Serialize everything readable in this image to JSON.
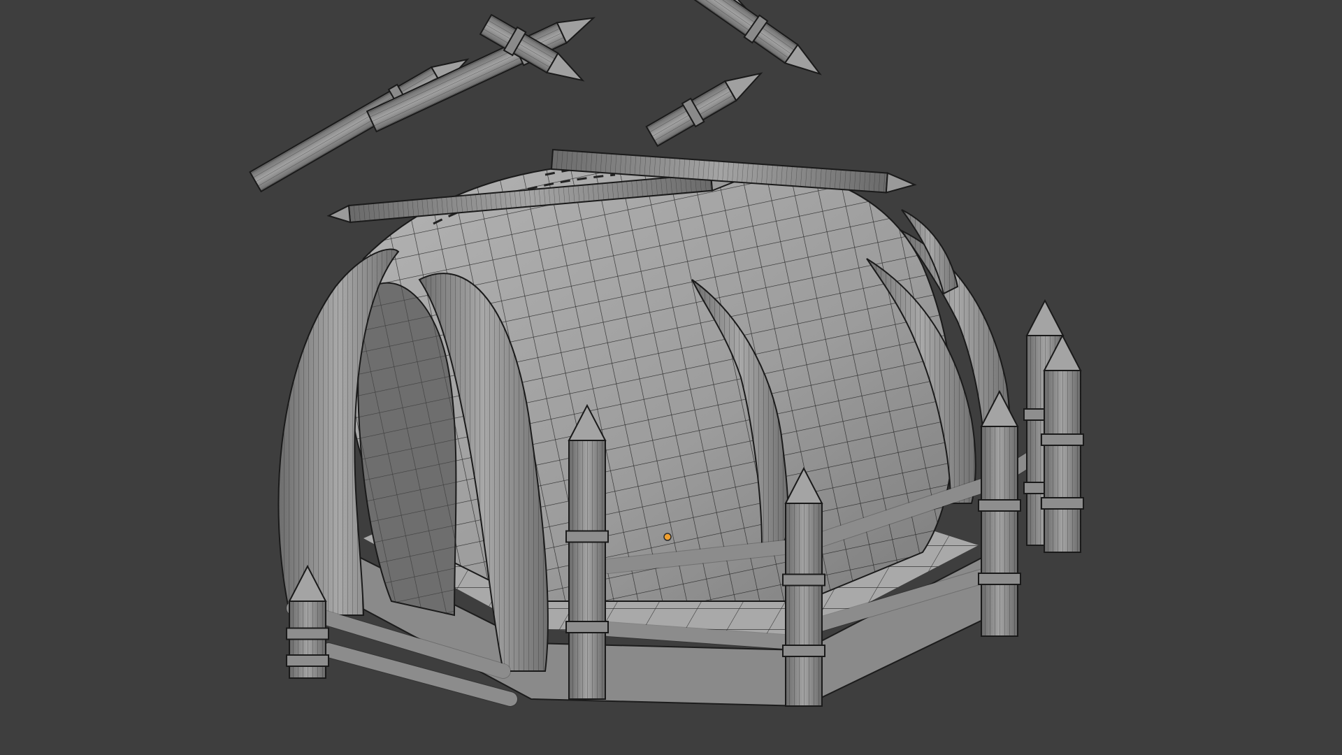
{
  "viewport": {
    "background_color": "#3e3e3e",
    "mode": "wireframe-overlay",
    "object_name": "",
    "selected_origin_color": "#f0a030"
  },
  "model": {
    "surface_color": "#9a9a9a",
    "wire_color": "#1a1a1a",
    "description_icons": [
      "tent-mesh",
      "horn-tusk",
      "wooden-stake",
      "fence-post"
    ]
  }
}
